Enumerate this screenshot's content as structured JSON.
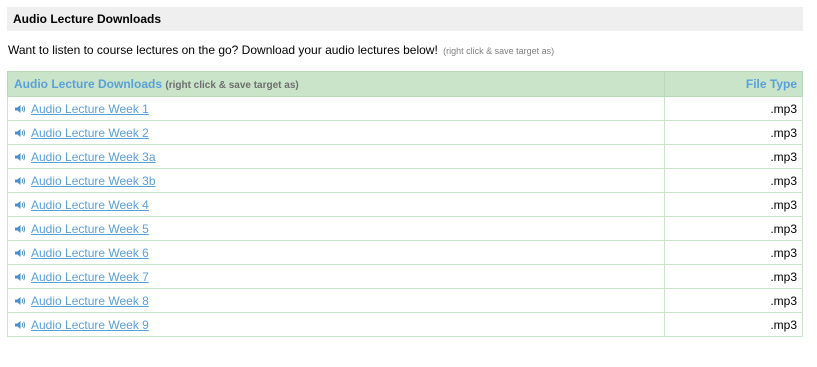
{
  "section": {
    "title": "Audio Lecture Downloads"
  },
  "intro": {
    "text": "Want to listen to course lectures on the go? Download your audio lectures below!",
    "hint": "(right click & save target as)"
  },
  "table": {
    "header_title": "Audio Lecture Downloads",
    "header_hint": "(right click & save target as)",
    "header_type": "File Type",
    "rows": [
      {
        "label": "Audio Lecture Week 1",
        "type": ".mp3",
        "icon": "speaker-icon"
      },
      {
        "label": "Audio Lecture Week 2",
        "type": ".mp3",
        "icon": "speaker-icon"
      },
      {
        "label": "Audio Lecture Week 3a",
        "type": ".mp3",
        "icon": "speaker-icon"
      },
      {
        "label": "Audio Lecture Week 3b",
        "type": ".mp3",
        "icon": "speaker-icon"
      },
      {
        "label": "Audio Lecture Week 4",
        "type": ".mp3",
        "icon": "speaker-icon"
      },
      {
        "label": "Audio Lecture Week 5",
        "type": ".mp3",
        "icon": "speaker-icon"
      },
      {
        "label": "Audio Lecture Week 6",
        "type": ".mp3",
        "icon": "speaker-icon"
      },
      {
        "label": "Audio Lecture Week 7",
        "type": ".mp3",
        "icon": "speaker-icon"
      },
      {
        "label": "Audio Lecture Week 8",
        "type": ".mp3",
        "icon": "speaker-icon"
      },
      {
        "label": "Audio Lecture Week 9",
        "type": ".mp3",
        "icon": "speaker-icon"
      }
    ]
  },
  "colors": {
    "link": "#5aa0d8",
    "header_bg": "#c9e4c9",
    "section_bg": "#efefef"
  }
}
